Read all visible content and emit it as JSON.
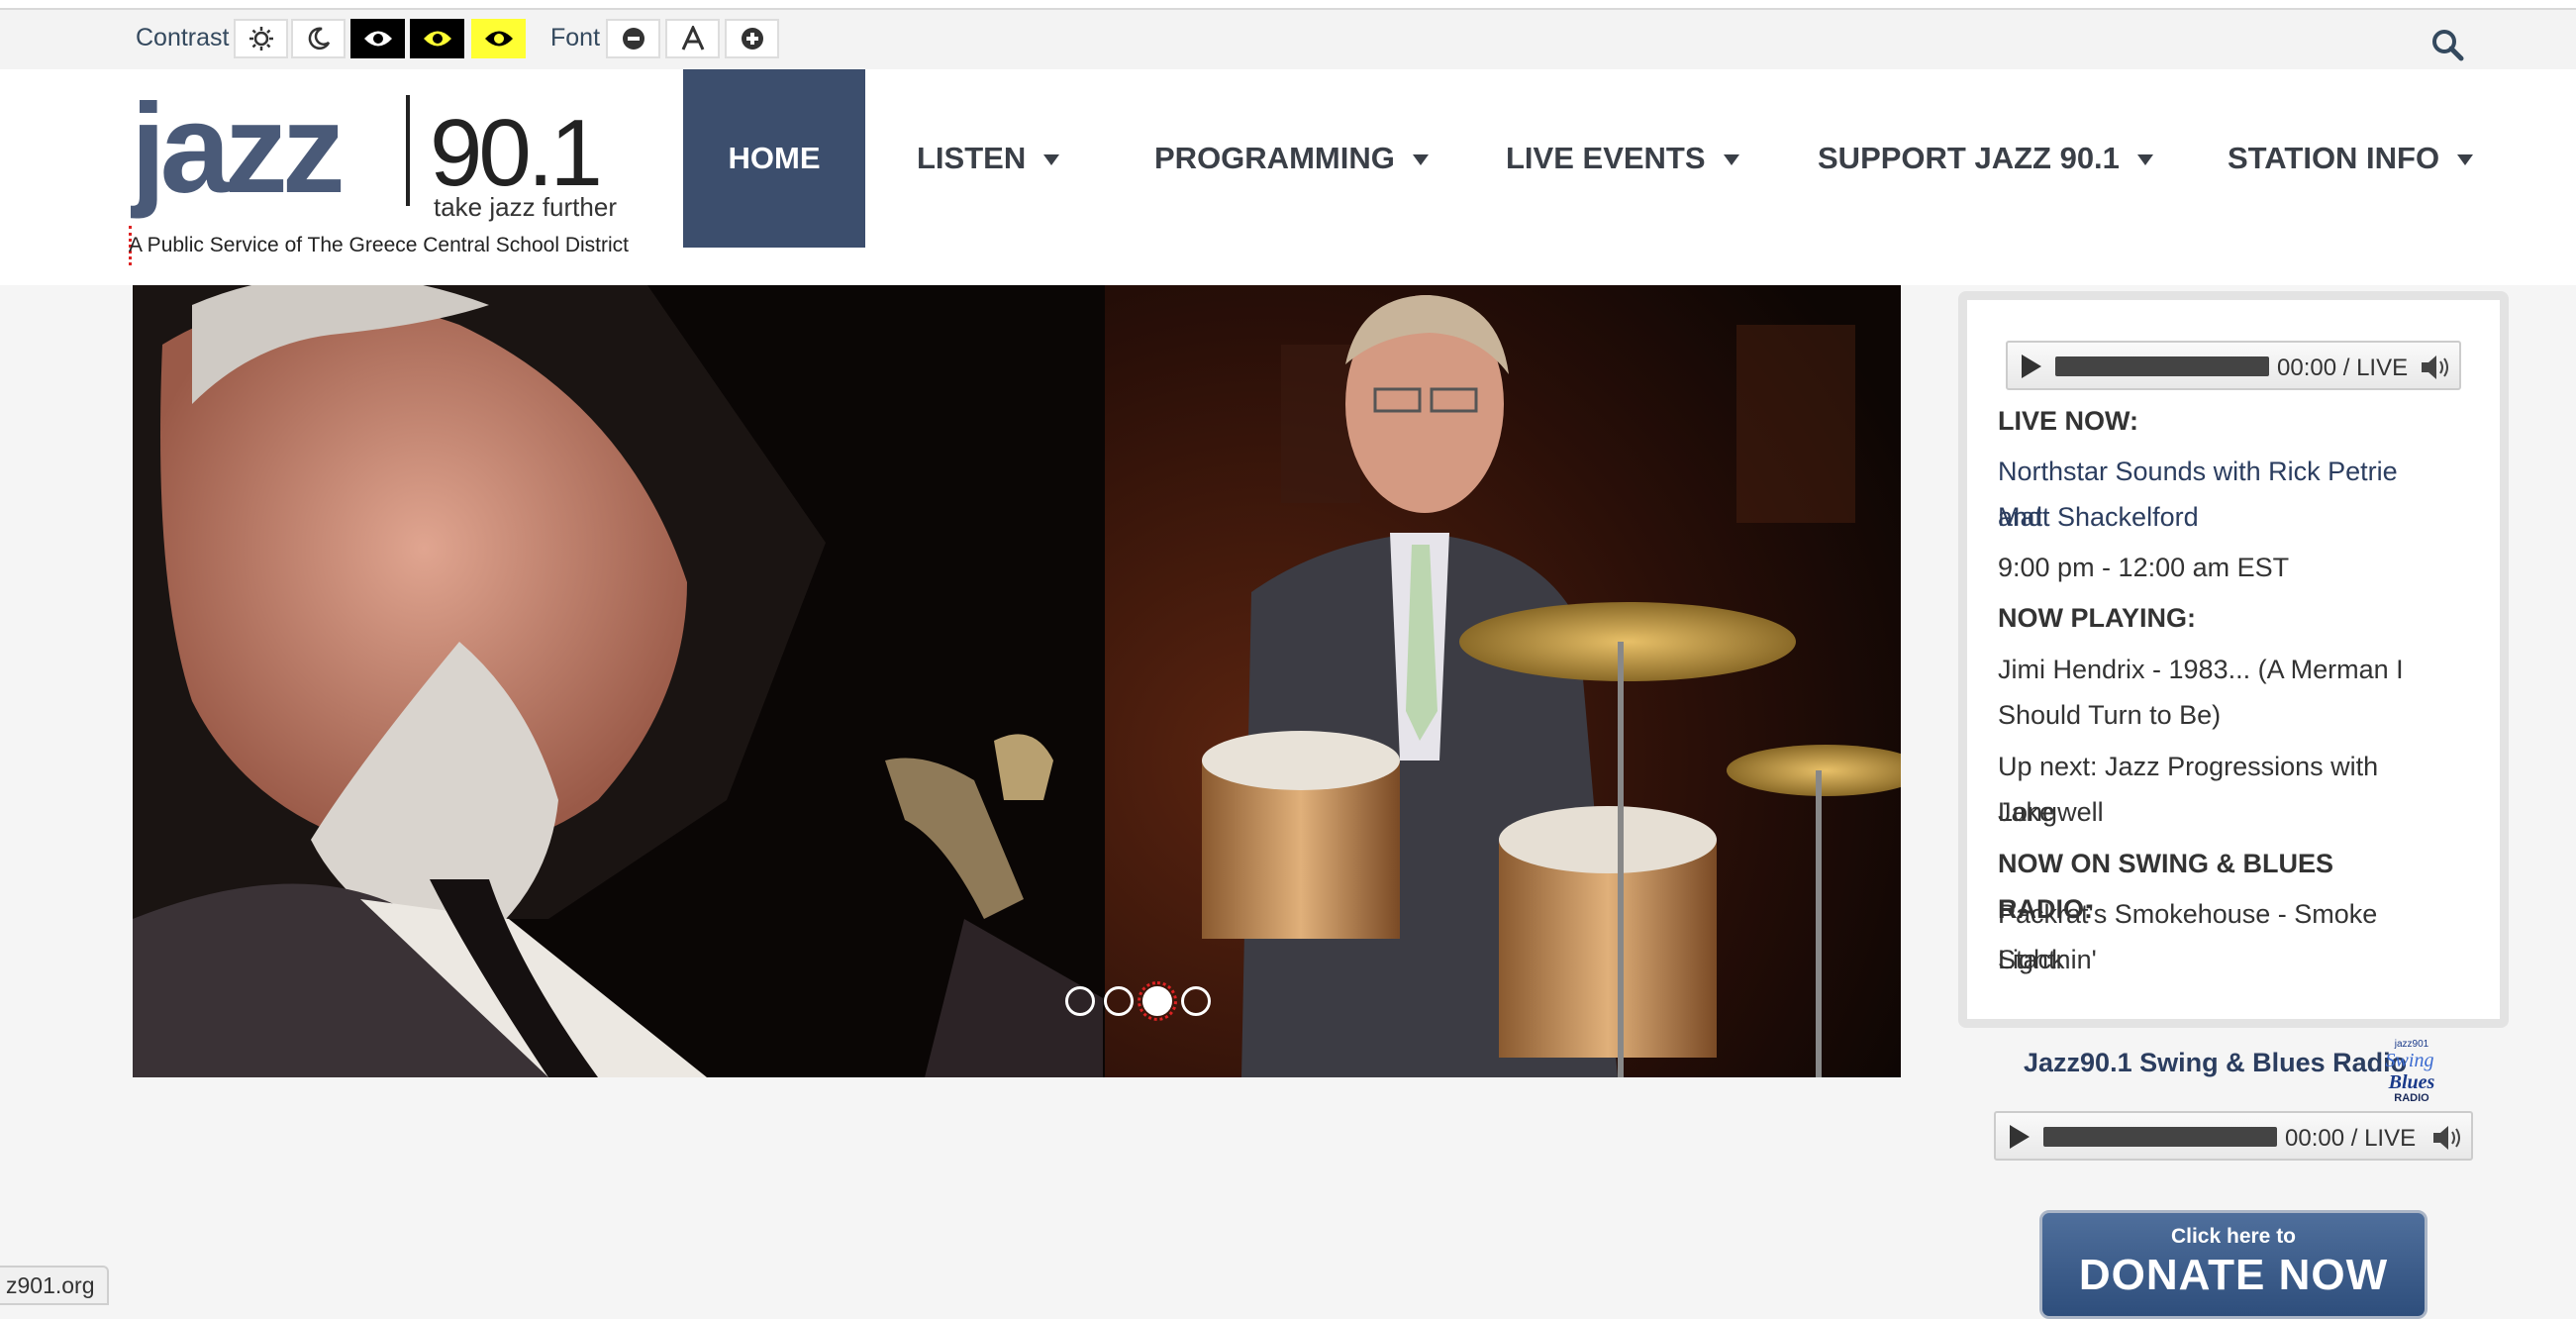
{
  "accessibility": {
    "contrast_label": "Contrast",
    "font_label": "Font",
    "contrast_buttons": [
      "sun-icon",
      "moon-icon",
      "eye-white-on-black-icon",
      "eye-yellow-on-black-icon",
      "eye-black-on-yellow-icon"
    ],
    "font_buttons": [
      "minus-icon",
      "font-a-icon",
      "plus-icon"
    ]
  },
  "header": {
    "logo_word": "jazz",
    "logo_number": "90.1",
    "logo_tagline": "take jazz further",
    "tagline": "A Public Service of The Greece Central School District"
  },
  "nav": {
    "home": "HOME",
    "listen": "LISTEN",
    "programming": "PROGRAMMING",
    "live_events": "LIVE EVENTS",
    "support": "SUPPORT JAZZ 90.1",
    "station_info": "STATION INFO"
  },
  "slider": {
    "slide_count": 4,
    "active_slide": 3
  },
  "sidebar": {
    "player_time": "00:00 / LIVE",
    "live_now_label": "LIVE NOW:",
    "live_now_show_line1": "Northstar Sounds with Rick Petrie and",
    "live_now_show_line2": "Matt Shackelford",
    "live_now_time": "9:00 pm - 12:00 am EST",
    "now_playing_label": "NOW PLAYING:",
    "now_playing_line1": "Jimi Hendrix - 1983... (A Merman I",
    "now_playing_line2": "Should Turn to Be)",
    "up_next_line1": "Up next: Jazz Progressions with Jake",
    "up_next_line2": "Longwell",
    "swing_label": "NOW ON SWING & BLUES RADIO:",
    "swing_line1": "Packrat's Smokehouse - Smoke Stack",
    "swing_line2": "Lightnin'"
  },
  "swing_radio": {
    "title": "Jazz90.1 Swing & Blues Radio",
    "logo_top": "jazz901",
    "logo_swing": "Swing",
    "logo_blues": "Blues",
    "logo_radio": "RADIO",
    "player_time": "00:00 / LIVE"
  },
  "donate": {
    "small": "Click here to",
    "big": "DONATE NOW"
  },
  "status_bar": {
    "url": "z901.org"
  },
  "colors": {
    "nav_active_bg": "#3c4e6d",
    "link": "#2b3d5f",
    "donate": "#3a5a88"
  }
}
